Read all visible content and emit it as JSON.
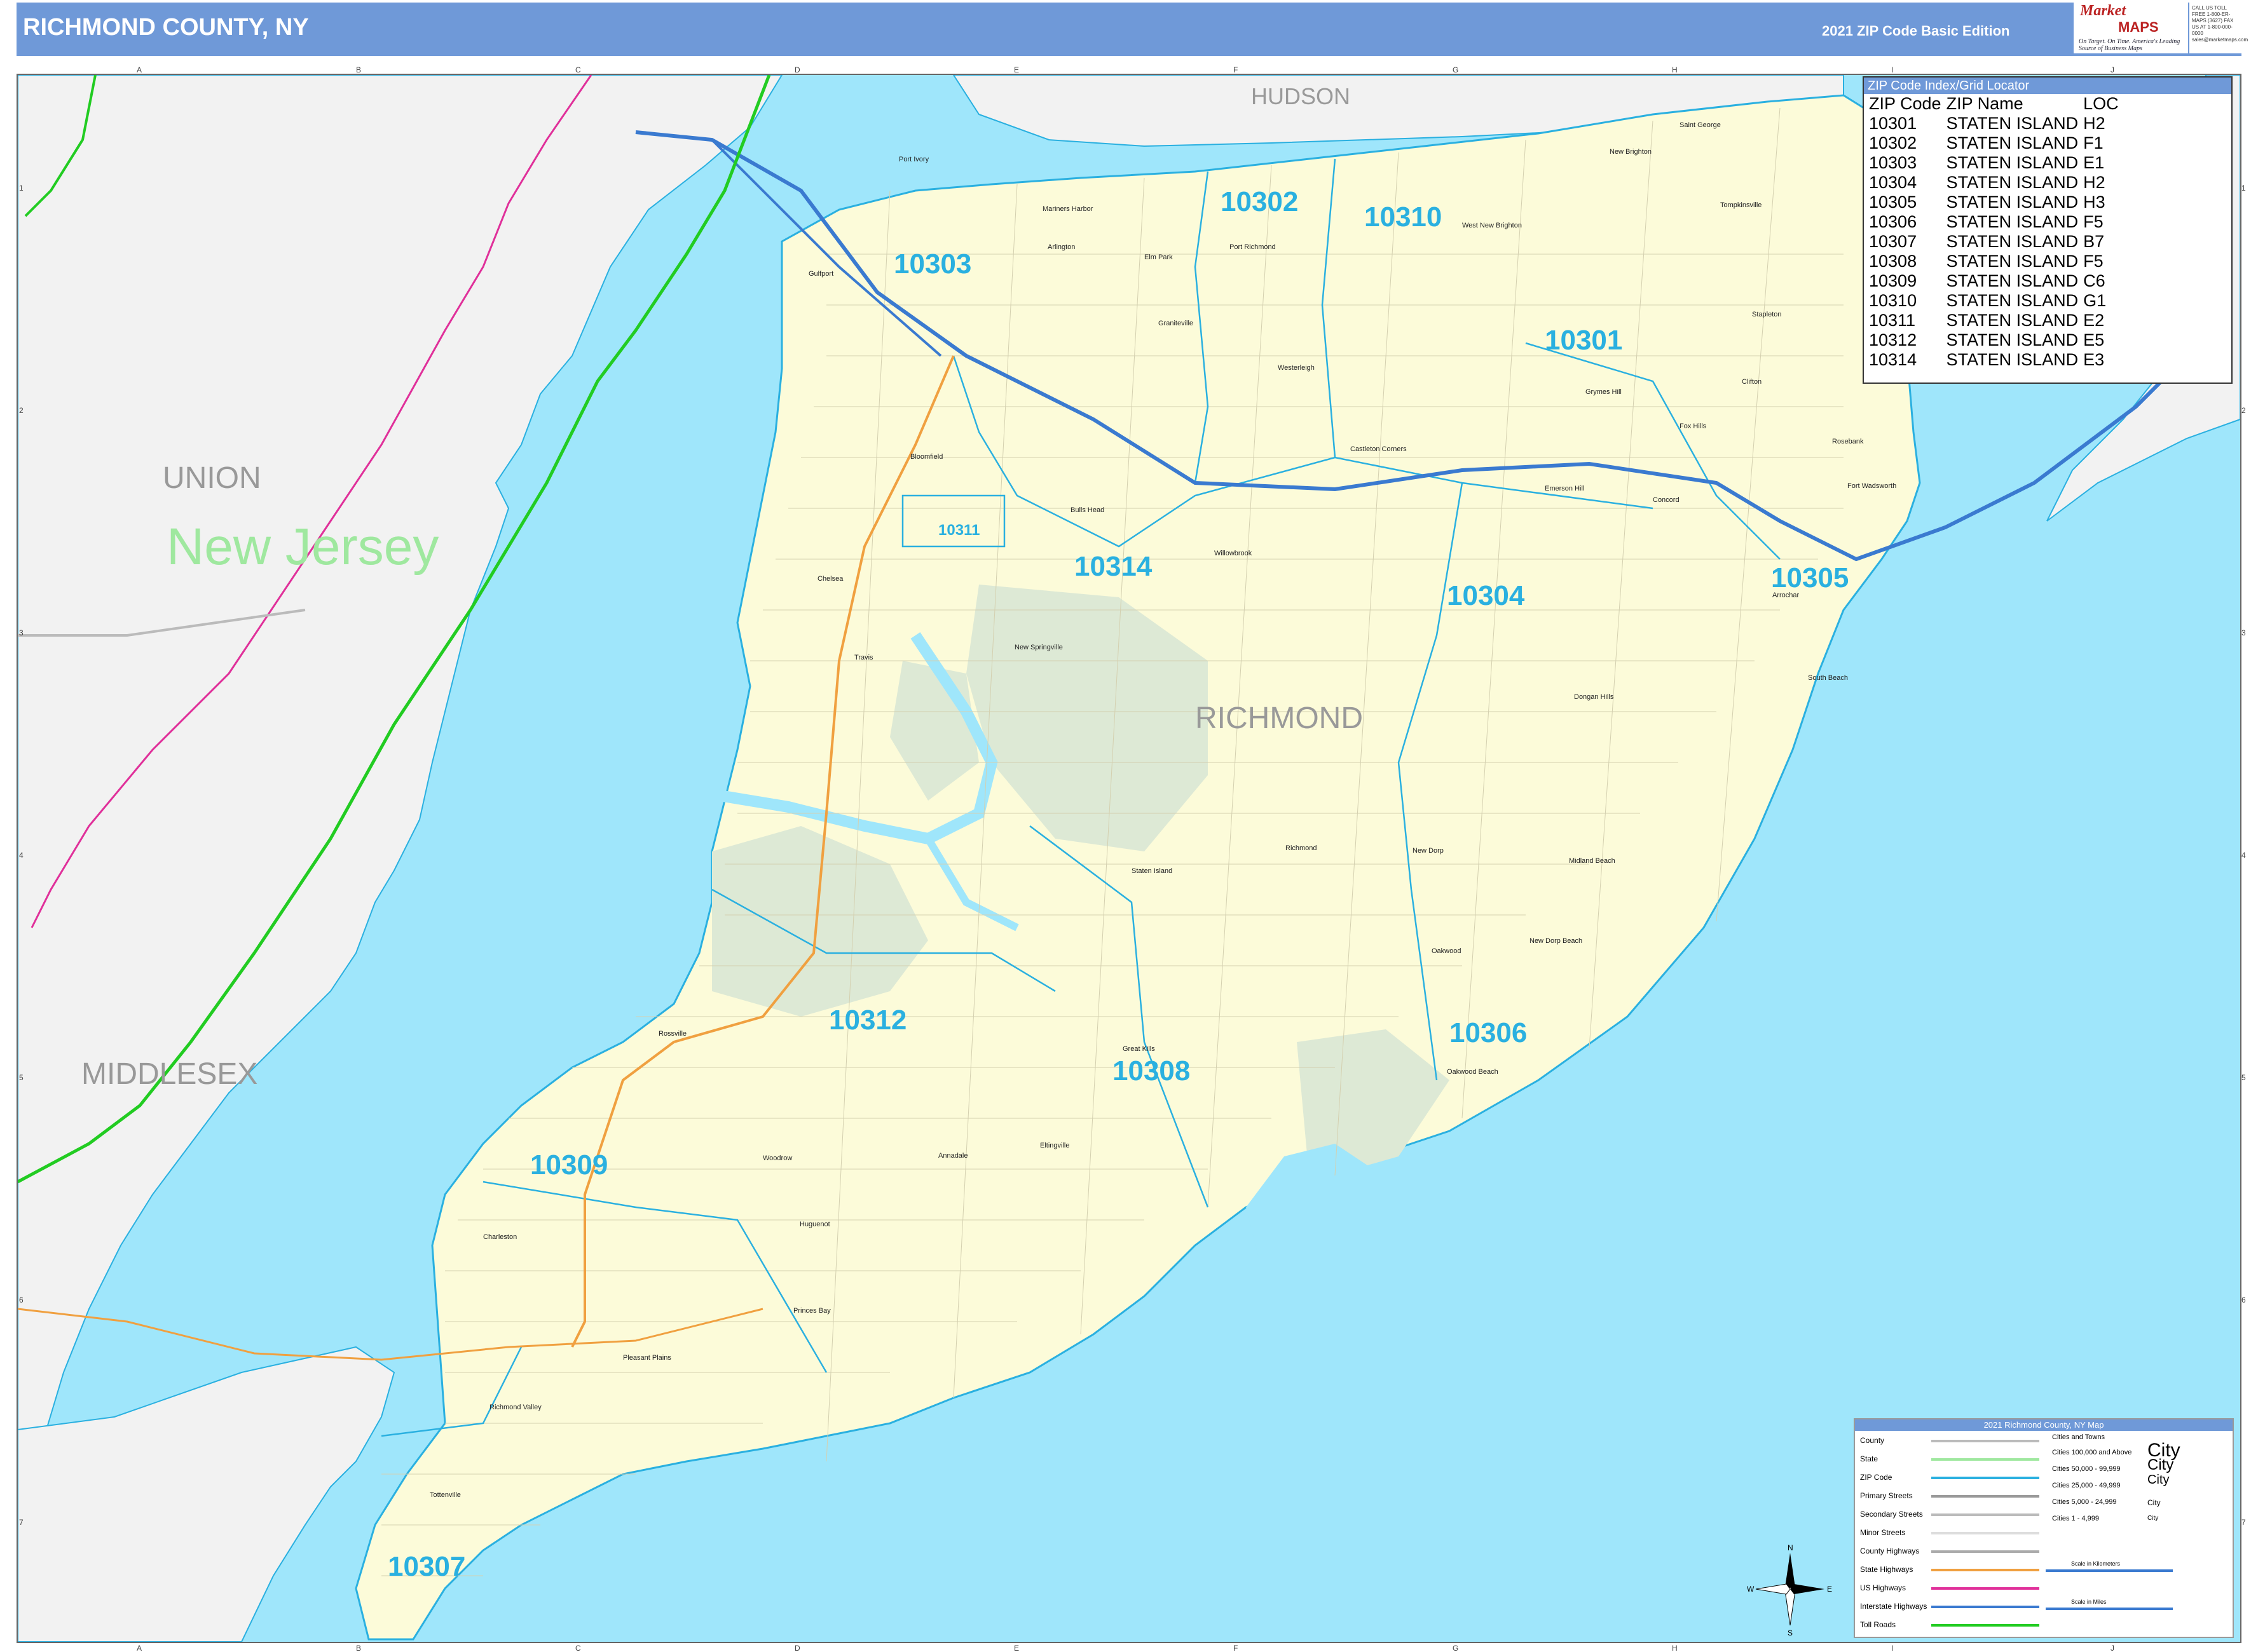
{
  "header": {
    "title": "RICHMOND COUNTY, NY",
    "edition": "2021 ZIP Code Basic Edition",
    "logo_top": "Market",
    "logo_mid": "MAPS",
    "logo_tag": "On Target. On Time. America's Leading Source of Business Maps",
    "contact": "CALL US TOLL FREE 1-800-ER-MAPS (3627) FAX US AT 1-800-000-0000 sales@marketmaps.com"
  },
  "grid": {
    "cols": [
      "A",
      "B",
      "C",
      "D",
      "E",
      "F",
      "G",
      "H",
      "I",
      "J"
    ],
    "rows": [
      "1",
      "2",
      "3",
      "4",
      "5",
      "6",
      "7"
    ]
  },
  "regions": {
    "state": "New Jersey",
    "counties": [
      "UNION",
      "MIDDLESEX",
      "HUDSON",
      "RICHMOND"
    ]
  },
  "zip_labels": [
    "10303",
    "10302",
    "10310",
    "10301",
    "10311",
    "10314",
    "10304",
    "10305",
    "10312",
    "10308",
    "10306",
    "10309",
    "10307"
  ],
  "places": [
    "Port Ivory",
    "Mariners Harbor",
    "Arlington",
    "Elm Park",
    "Port Richmond",
    "West New Brighton",
    "New Brighton",
    "Saint George",
    "Tompkinsville",
    "Stapleton",
    "Clifton",
    "Grymes Hill",
    "Fox Hills",
    "Rosebank",
    "Fort Wadsworth",
    "Concord",
    "Emerson Hill",
    "Castleton Corners",
    "Westerleigh",
    "Graniteville",
    "Gulfport",
    "Bloomfield",
    "Bulls Head",
    "Willowbrook",
    "Chelsea",
    "Travis",
    "New Springville",
    "Arrochar",
    "South Beach",
    "Dongan Hills",
    "Richmond",
    "New Dorp",
    "Midland Beach",
    "Staten Island",
    "Oakwood",
    "New Dorp Beach",
    "Great Kills",
    "Oakwood Beach",
    "Rossville",
    "Woodrow",
    "Annadale",
    "Eltingville",
    "Huguenot",
    "Charleston",
    "Princes Bay",
    "Pleasant Plains",
    "Richmond Valley",
    "Tottenville"
  ],
  "zip_index": {
    "title": "ZIP Code Index/Grid Locator",
    "headers": [
      "ZIP Code",
      "ZIP Name",
      "LOC"
    ],
    "rows": [
      [
        "10301",
        "STATEN ISLAND",
        "H2"
      ],
      [
        "10302",
        "STATEN ISLAND",
        "F1"
      ],
      [
        "10303",
        "STATEN ISLAND",
        "E1"
      ],
      [
        "10304",
        "STATEN ISLAND",
        "H2"
      ],
      [
        "10305",
        "STATEN ISLAND",
        "H3"
      ],
      [
        "10306",
        "STATEN ISLAND",
        "F5"
      ],
      [
        "10307",
        "STATEN ISLAND",
        "B7"
      ],
      [
        "10308",
        "STATEN ISLAND",
        "F5"
      ],
      [
        "10309",
        "STATEN ISLAND",
        "C6"
      ],
      [
        "10310",
        "STATEN ISLAND",
        "G1"
      ],
      [
        "10311",
        "STATEN ISLAND",
        "E2"
      ],
      [
        "10312",
        "STATEN ISLAND",
        "E5"
      ],
      [
        "10314",
        "STATEN ISLAND",
        "E3"
      ]
    ]
  },
  "legend": {
    "title": "2021 Richmond County, NY Map",
    "items": [
      {
        "label": "County",
        "color": "#bbbbbb"
      },
      {
        "label": "State",
        "color": "#9fe89f"
      },
      {
        "label": "ZIP Code",
        "color": "#2ab0e0"
      },
      {
        "label": "Primary Streets",
        "color": "#999999"
      },
      {
        "label": "Secondary Streets",
        "color": "#bbbbbb"
      },
      {
        "label": "Minor Streets",
        "color": "#dddddd"
      },
      {
        "label": "County Highways",
        "color": "#aaaaaa"
      },
      {
        "label": "State Highways",
        "color": "#f0a040"
      },
      {
        "label": "US Highways",
        "color": "#e0309a"
      },
      {
        "label": "Interstate Highways",
        "color": "#3a7ad0"
      },
      {
        "label": "Toll Roads",
        "color": "#22cc22"
      }
    ],
    "cities_title": "Cities and Towns",
    "cities": [
      {
        "label": "Cities 100,000 and Above",
        "name": "City"
      },
      {
        "label": "Cities 50,000 - 99,999",
        "name": "City"
      },
      {
        "label": "Cities 25,000 - 49,999",
        "name": "City"
      },
      {
        "label": "Cities 5,000 - 24,999",
        "name": "City"
      },
      {
        "label": "Cities 1 - 4,999",
        "name": "City"
      }
    ],
    "scale_km": "Scale in Kilometers",
    "scale_mi": "Scale in Miles"
  },
  "compass": {
    "n": "N",
    "s": "S",
    "e": "E",
    "w": "W"
  },
  "colors": {
    "water": "#9fe6fb",
    "land_si": "#fcfbd9",
    "land_nj": "#f2f2f2",
    "park": "#dde9d5",
    "zip_line": "#2ab0e0",
    "header": "#6f99d8"
  }
}
